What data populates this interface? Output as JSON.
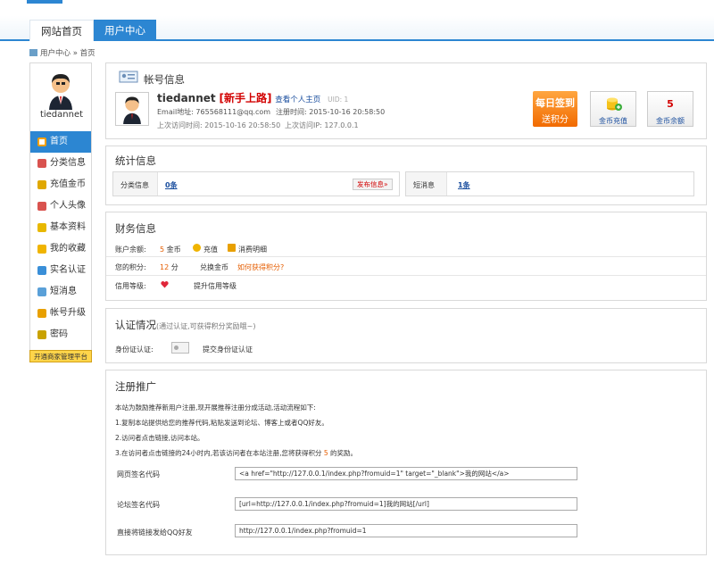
{
  "nav": {
    "home": "网站首页",
    "user": "用户中心"
  },
  "breadcrumb": "用户中心 » 首页",
  "sidebar": {
    "username": "tiedannet",
    "items": [
      {
        "label": "首页",
        "icon": "house-icon",
        "color": "#f1a000"
      },
      {
        "label": "分类信息",
        "icon": "edit-icon",
        "color": "#d9534f"
      },
      {
        "label": "充值金币",
        "icon": "coins-icon",
        "color": "#e0a800"
      },
      {
        "label": "个人头像",
        "icon": "portrait-icon",
        "color": "#d9534f"
      },
      {
        "label": "基本资料",
        "icon": "notebook-icon",
        "color": "#e8b800"
      },
      {
        "label": "我的收藏",
        "icon": "star-icon",
        "color": "#f0b400"
      },
      {
        "label": "实名认证",
        "icon": "id-card-icon",
        "color": "#3a8fd8"
      },
      {
        "label": "短消息",
        "icon": "chat-icon",
        "color": "#5aa0d8"
      },
      {
        "label": "帐号升级",
        "icon": "user-up-icon",
        "color": "#e8a000"
      },
      {
        "label": "密码",
        "icon": "lock-icon",
        "color": "#c9a200"
      }
    ],
    "merchant": "开通商家管理平台"
  },
  "account": {
    "title": "帐号信息",
    "username": "tiedannet",
    "rank": "[新手上路]",
    "homepage_link": "查看个人主页",
    "uid": "UID: 1",
    "email": "Email地址: 765568111@qq.com",
    "reg_time": "注册时间: 2015-10-16 20:58:50",
    "last_visit": "上次访问时间: 2015-10-16 20:58:50",
    "last_ip": "上次访问IP: 127.0.0.1",
    "sign_l1": "每日签到",
    "sign_l2": "送积分",
    "recharge": "金币充值",
    "balance_value": "5",
    "balance_label": "金币余额"
  },
  "stats": {
    "title": "统计信息",
    "cat_label": "分类信息",
    "cat_value": "0条",
    "publish_btn": "发布信息»",
    "msg_label": "短消息",
    "msg_value": "1条"
  },
  "finance": {
    "title": "财务信息",
    "balance_label": "账户余额:",
    "balance_value": "5",
    "balance_unit": "金币",
    "recharge_link": "充值",
    "detail_link": "消费明细",
    "points_label": "您的积分:",
    "points_value": "12",
    "points_unit": "分",
    "exchange_link": "兑换金币",
    "how_link": "如何获得积分?",
    "credit_label": "信用等级:",
    "credit_link": "提升信用等级"
  },
  "verify": {
    "title": "认证情况",
    "note": "(通过认证,可获得积分奖励哦~)",
    "id_label": "身份证认证:",
    "id_link": "提交身份证认证"
  },
  "promo": {
    "title": "注册推广",
    "intro": "本站为鼓励推荐新用户注册,现开展推荐注册分成活动,活动流程如下:",
    "step1": "1.复制本站提供给您的推荐代码,粘贴发送到论坛、博客上或者QQ好友。",
    "step2": "2.访问者点击链接,访问本站。",
    "step3a": "3.在访问者点击链接的24小时内,若该访问者在本站注册,您将获得积分",
    "step3n": "5",
    "step3b": "的奖励。",
    "web_label": "网页签名代码",
    "web_value": "<a href=\"http://127.0.0.1/index.php?fromuid=1\" target=\"_blank\">我的网站</a>",
    "bbs_label": "论坛签名代码",
    "bbs_value": "[url=http://127.0.0.1/index.php?fromuid=1]我的网站[/url]",
    "qq_label": "直接将链接发给QQ好友",
    "qq_value": "http://127.0.0.1/index.php?fromuid=1"
  }
}
